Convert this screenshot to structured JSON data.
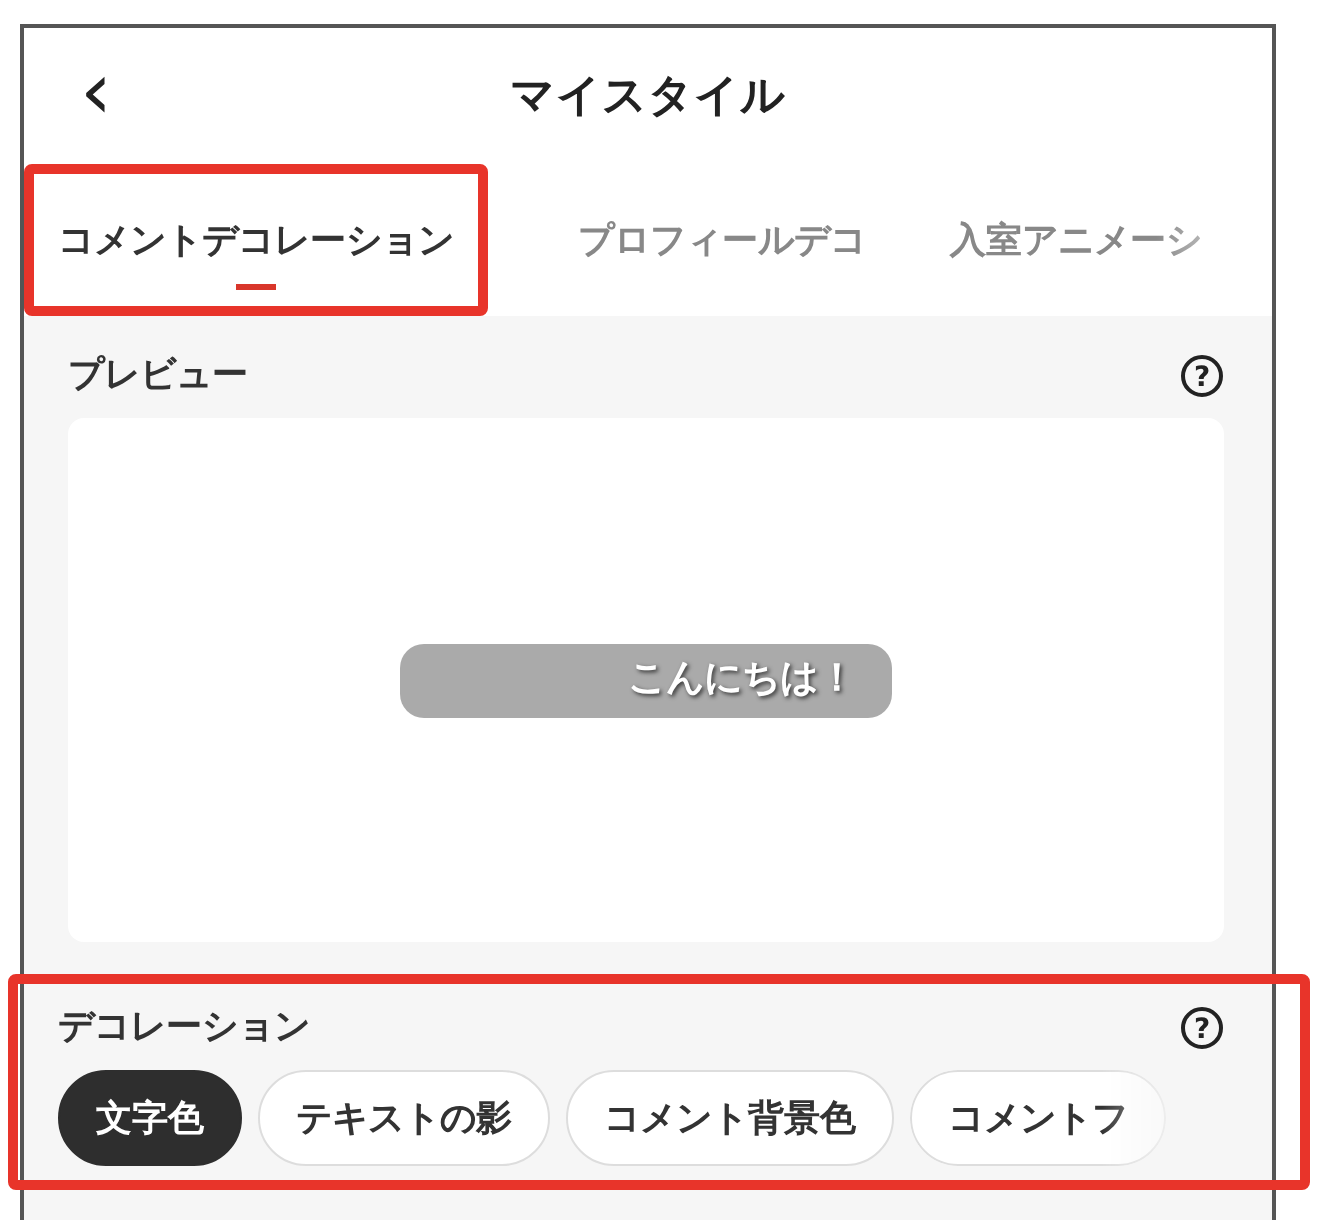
{
  "header": {
    "back": "‹",
    "title": "マイスタイル"
  },
  "tabs": [
    {
      "label": "コメントデコレーション",
      "selected": true,
      "highlighted": true
    },
    {
      "label": "プロフィールデコ",
      "selected": false,
      "highlighted": false
    },
    {
      "label": "入室アニメーシ",
      "selected": false,
      "highlighted": false
    }
  ],
  "preview": {
    "title": "プレビュー",
    "help": "?",
    "bubble_text": "こんにちは！"
  },
  "decoration": {
    "title": "デコレーション",
    "help": "?",
    "highlighted": true,
    "chips": [
      {
        "label": "文字色",
        "selected": true
      },
      {
        "label": "テキストの影",
        "selected": false
      },
      {
        "label": "コメント背景色",
        "selected": false
      },
      {
        "label": "コメントフ",
        "selected": false
      }
    ]
  }
}
